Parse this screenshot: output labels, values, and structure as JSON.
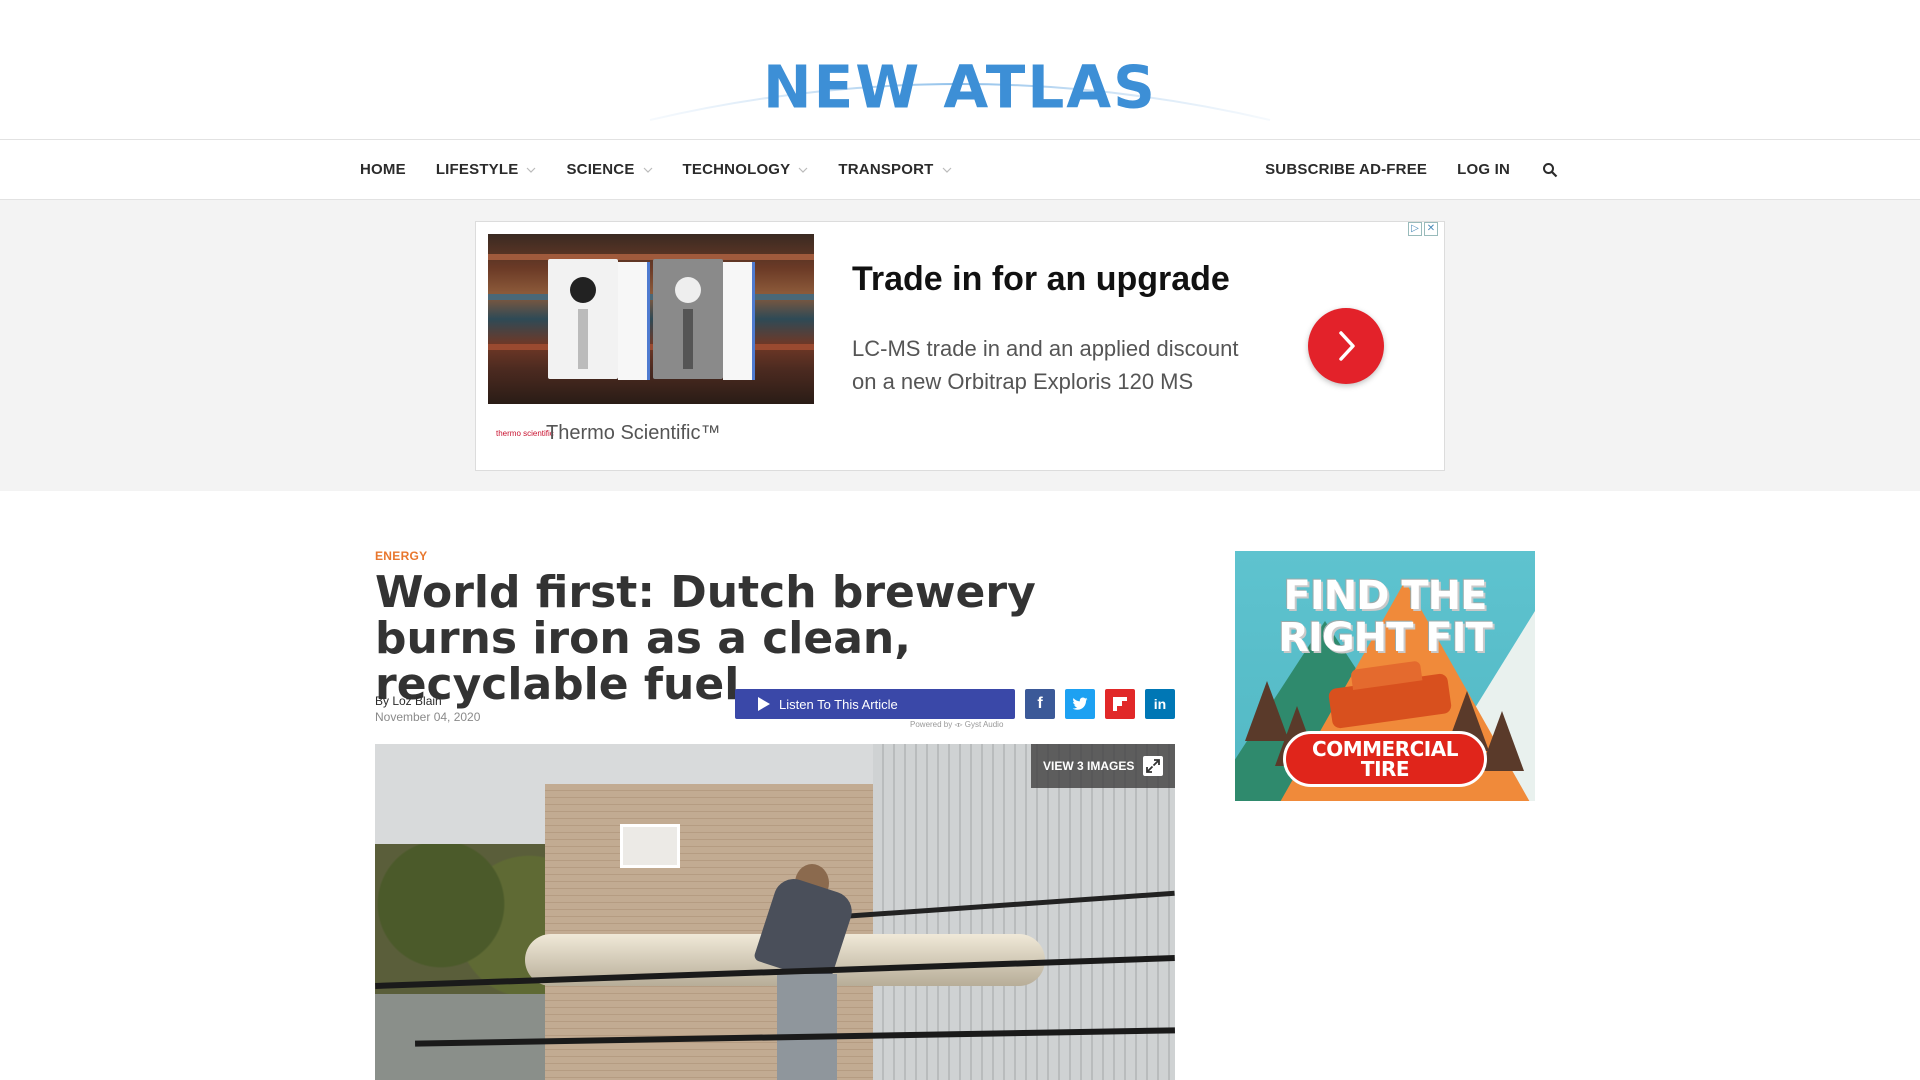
{
  "brand": {
    "logo_text": "NEW ATLAS"
  },
  "nav": {
    "items": [
      {
        "label": "HOME",
        "has_dropdown": false
      },
      {
        "label": "LIFESTYLE",
        "has_dropdown": true
      },
      {
        "label": "SCIENCE",
        "has_dropdown": true
      },
      {
        "label": "TECHNOLOGY",
        "has_dropdown": true
      },
      {
        "label": "TRANSPORT",
        "has_dropdown": true
      }
    ],
    "subscribe_label": "SUBSCRIBE AD-FREE",
    "login_label": "LOG IN",
    "search_icon": "search-icon"
  },
  "banner_ad": {
    "headline": "Trade in for an upgrade",
    "body": "LC-MS trade in and an applied discount on a new Orbitrap Exploris 120 MS",
    "brand": "Thermo Scientific™",
    "brand_logo_text": "thermo scientific",
    "cta_icon": "chevron-right-icon",
    "cta_color": "#e3222a"
  },
  "article": {
    "category": "ENERGY",
    "title": "World first: Dutch brewery burns iron as a clean, recyclable fuel",
    "byline": "By Loz Blain",
    "date": "November 04, 2020",
    "listen_label": "Listen To This Article",
    "powered_by": "Powered by  ◃▹ Gyst Audio",
    "share": [
      {
        "network": "facebook",
        "glyph": "f",
        "color": "#3b5998"
      },
      {
        "network": "twitter",
        "glyph": "t",
        "color": "#1da1f2"
      },
      {
        "network": "flipboard",
        "glyph": "f",
        "color": "#e12828"
      },
      {
        "network": "linkedin",
        "glyph": "in",
        "color": "#0077b5"
      }
    ],
    "view_images_label": "VIEW 3 IMAGES"
  },
  "side_ad": {
    "headline": "FIND THE RIGHT FIT",
    "badge_line1": "COMMERCIAL",
    "badge_line2": "TIRE"
  },
  "colors": {
    "accent_category": "#e8772e",
    "logo_blue": "#3d8fd6",
    "listen_button": "#3a48a8"
  }
}
